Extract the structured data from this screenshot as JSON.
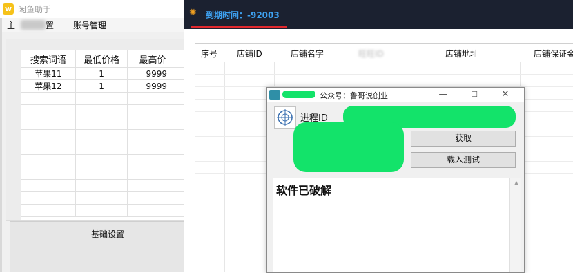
{
  "left_window": {
    "title": "闲鱼助手",
    "menu": [
      "主",
      "置",
      "账号管理"
    ],
    "grid": {
      "headers": [
        "搜索词语",
        "最低价格",
        "最高价"
      ],
      "rows": [
        [
          "苹果11",
          "1",
          "9999"
        ],
        [
          "苹果12",
          "1",
          "9999"
        ]
      ]
    },
    "group_label": "基础设置"
  },
  "right_window": {
    "expiry_text": "到期时间：-92003",
    "columns": [
      "序号",
      "店铺ID",
      "店铺名字",
      "旺旺ID",
      "店铺地址",
      "店铺保证金"
    ]
  },
  "dialog": {
    "title": "公众号：鲁哥说创业",
    "minimize": "—",
    "maximize": "☐",
    "close": "✕",
    "pid_label": "进程ID",
    "fetch_button": "获取",
    "load_test_button": "载入测试",
    "text_content": "软件已破解"
  },
  "colors": {
    "header_bg": "#1b2130",
    "expiry_text": "#3ea2f2",
    "underline": "#e0282e",
    "redaction": "#13e36a"
  }
}
